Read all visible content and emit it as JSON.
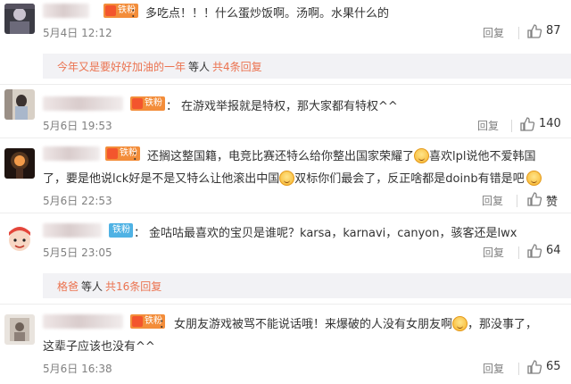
{
  "ui": {
    "reply_label": "回复",
    "sep": "：",
    "fan_badge": "铁粉",
    "sub_prefix": "等人"
  },
  "comments": [
    {
      "text": "多吃点！！！什么蛋炒饭啊。汤啊。水果什么的",
      "time": "5月4日 12:12",
      "likes": "87",
      "sub": {
        "highlight": "今年又是要好好加油的一年",
        "prefix": "等人",
        "count": "共4条回复"
      }
    },
    {
      "text": "在游戏举报就是特权，那大家都有特权^^",
      "time": "5月6日 19:53",
      "likes": "140"
    },
    {
      "text_a": "还搁这整国籍，电竞比赛还特么给你整出国家荣耀了",
      "text_b": "喜欢lpl说他不爱韩国",
      "text_c": "了，要是他说lck好是不是又特么让他滚出中国",
      "text_d": "双标你们最会了，反正啥都是doinb有错是吧",
      "time": "5月6日 22:53",
      "likes": "赞"
    },
    {
      "text": "金咕咕最喜欢的宝贝是谁呢？karsa，karnavi，canyon，骇客还是lwx",
      "time": "5月5日 23:05",
      "likes": "64",
      "sub": {
        "highlight": "格爸",
        "prefix": "等人",
        "count": "共16条回复"
      }
    },
    {
      "text_a": "女朋友游戏被骂不能说话哦！来爆破的人没有女朋友啊",
      "text_b": "，那没事了，",
      "text_c": "这辈子应该也没有^^",
      "time": "5月6日 16:38",
      "likes": "65"
    }
  ]
}
